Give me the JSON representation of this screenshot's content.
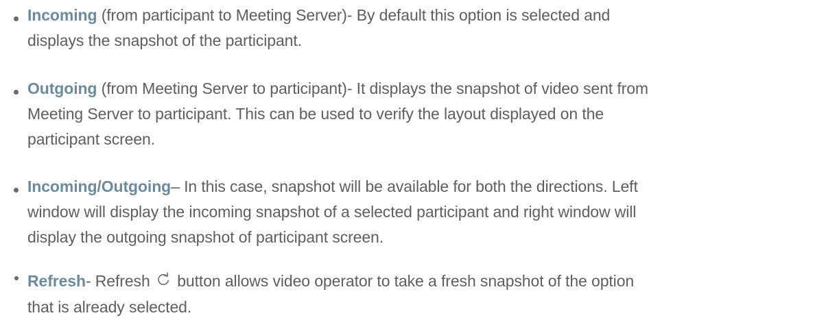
{
  "items": [
    {
      "term": "Incoming",
      "line1": " (from participant to Meeting Server)-  By default this option is selected and",
      "line2": "displays the snapshot of the participant."
    },
    {
      "term": "Outgoing",
      "line1": " (from Meeting Server to participant)-  It displays the snapshot of video sent from",
      "line2": "Meeting Server to participant. This can be used to verify the layout displayed on the",
      "line3": "participant screen."
    },
    {
      "term": "Incoming/Outgoing",
      "line1": "– In this case, snapshot will be available for both the directions. Left",
      "line2": "window will display the incoming snapshot of a selected participant and right window will",
      "line3": "display the outgoing snapshot of participant screen."
    },
    {
      "term": "Refresh",
      "line1_before": "-  Refresh ",
      "icon": "refresh-icon",
      "line1_after": " button allows video operator to take a fresh snapshot of the option",
      "line2": "that is already selected."
    }
  ],
  "colors": {
    "text": "#5e5e5e",
    "term": "#6c8a9d"
  }
}
